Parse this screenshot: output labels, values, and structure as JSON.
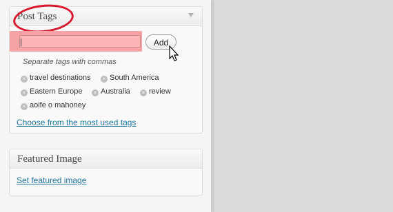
{
  "post_tags": {
    "title": "Post Tags",
    "add_label": "Add",
    "input_value": "",
    "howto": "Separate tags with commas",
    "tags": [
      "travel destinations",
      "South America",
      "Eastern Europe",
      "Australia",
      "review",
      "aoife o mahoney"
    ],
    "most_used_link": "Choose from the most used tags"
  },
  "featured_image": {
    "title": "Featured Image",
    "set_link": "Set featured image"
  },
  "colors": {
    "annotation_ring": "#d8182e",
    "annotation_highlight": "#f6a3a6",
    "link": "#21759b"
  }
}
